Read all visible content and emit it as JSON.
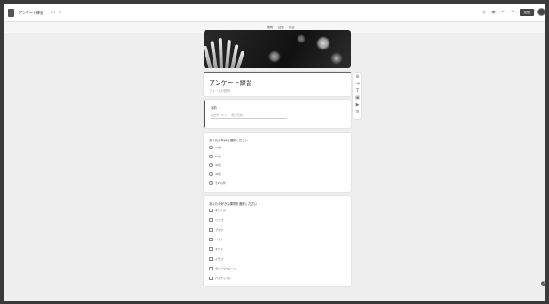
{
  "header": {
    "doc_title": "アンケート練習",
    "tabs": [
      "質問",
      "回答",
      "設定"
    ],
    "send_label": "送信",
    "icons": [
      "folder-icon",
      "star-icon",
      "palette-icon",
      "eye-icon",
      "undo-icon",
      "redo-icon",
      "more-icon"
    ]
  },
  "form": {
    "title": "アンケート練習",
    "description": "フォームの説明",
    "q1": {
      "label": "名前",
      "placeholder": "記述式テキスト（短文回答）"
    },
    "q2": {
      "label": "あなたの年代を選択ください",
      "options": [
        "10代",
        "20代",
        "30代",
        "40代",
        "それ以外"
      ]
    },
    "q3": {
      "label": "あなたの好きな果物を選択ください",
      "options": [
        "オレンジ",
        "リンゴ",
        "ブドウ",
        "バナナ",
        "キウイ",
        "イチゴ",
        "グレープフルーツ",
        "パイナップル"
      ]
    }
  },
  "sidebar": {
    "icons": [
      "add-question-icon",
      "import-icon",
      "title-text-icon",
      "image-icon",
      "video-icon",
      "section-icon"
    ]
  }
}
